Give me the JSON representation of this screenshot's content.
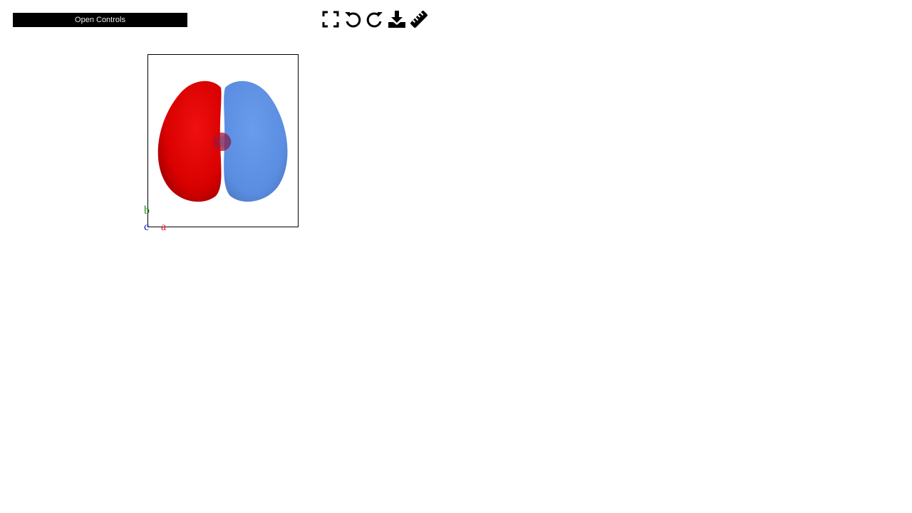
{
  "controls": {
    "open_label": "Open Controls"
  },
  "toolbar": {
    "items": [
      {
        "icon": "fullscreen-icon"
      },
      {
        "icon": "undo-icon"
      },
      {
        "icon": "redo-icon"
      },
      {
        "icon": "download-icon"
      },
      {
        "icon": "ruler-icon"
      }
    ]
  },
  "viewer": {
    "lobes": [
      {
        "name": "negative-lobe",
        "color": "#e00000"
      },
      {
        "name": "positive-lobe",
        "color": "#5a8fe0"
      }
    ],
    "axes": {
      "a": {
        "label": "a",
        "color": "#e02020"
      },
      "b": {
        "label": "b",
        "color": "#1a8a1a"
      },
      "c": {
        "label": "c",
        "color": "#2020e0"
      }
    }
  }
}
